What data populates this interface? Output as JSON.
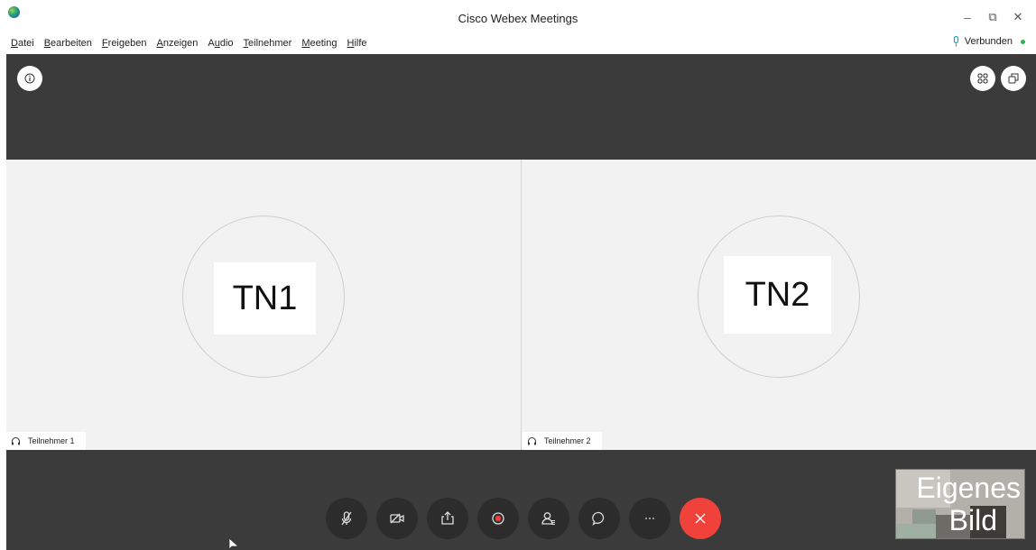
{
  "window": {
    "title": "Cisco Webex Meetings",
    "controls": {
      "minimize": "–",
      "restore": "⧉",
      "close": "✕"
    }
  },
  "menu": [
    {
      "key": "D",
      "rest": "atei"
    },
    {
      "key": "B",
      "rest": "earbeiten"
    },
    {
      "key": "F",
      "rest": "reigeben"
    },
    {
      "key": "A",
      "rest": "nzeigen"
    },
    {
      "pre": "A",
      "key": "u",
      "rest": "dio"
    },
    {
      "key": "T",
      "rest": "eilnehmer"
    },
    {
      "key": "M",
      "rest": "eeting"
    },
    {
      "key": "H",
      "rest": "ilfe"
    }
  ],
  "status": {
    "label": "Verbunden",
    "dot_color": "#2bb24c"
  },
  "participants": [
    {
      "initials": "TN1",
      "name": "Teilnehmer 1"
    },
    {
      "initials": "TN2",
      "name": "Teilnehmer 2"
    }
  ],
  "controls": [
    {
      "name": "mute-button",
      "icon": "microphone-muted-icon"
    },
    {
      "name": "video-button",
      "icon": "video-off-icon"
    },
    {
      "name": "share-button",
      "icon": "share-icon"
    },
    {
      "name": "record-button",
      "icon": "record-icon"
    },
    {
      "name": "participants-button",
      "icon": "participants-icon"
    },
    {
      "name": "chat-button",
      "icon": "chat-icon"
    },
    {
      "name": "more-button",
      "icon": "more-icon"
    },
    {
      "name": "leave-button",
      "icon": "close-icon"
    }
  ],
  "self_view": {
    "line1": "Eigenes",
    "line2": "Bild"
  },
  "colors": {
    "dark_band": "#3b3b3b",
    "leave": "#f0413b",
    "tile_bg": "#f2f2f2"
  }
}
